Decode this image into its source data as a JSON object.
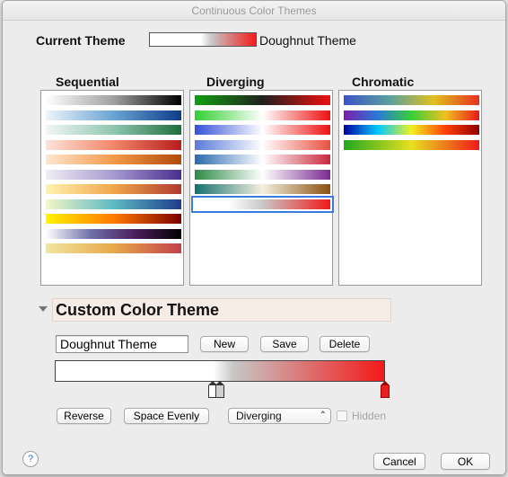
{
  "window": {
    "title": "Continuous Color Themes"
  },
  "current": {
    "label": "Current Theme",
    "name": "Doughnut Theme"
  },
  "columns": {
    "sequential": {
      "label": "Sequential",
      "swatches": [
        [
          "#ffffff",
          "#a0a0a0",
          "#000000"
        ],
        [
          "#eef4fb",
          "#6aa4d4",
          "#0d3d8a"
        ],
        [
          "#f3f6f5",
          "#8fc6b0",
          "#1f6e3c"
        ],
        [
          "#fde2d8",
          "#f2866b",
          "#b71d1d"
        ],
        [
          "#fde7cf",
          "#f39a4a",
          "#b24a0a"
        ],
        [
          "#f0eef6",
          "#a69ad0",
          "#4a2e8e"
        ],
        [
          "#fff3b0",
          "#f0a64a",
          "#b03a30"
        ],
        [
          "#f4f7c6",
          "#5fb9c4",
          "#1e3c8c"
        ],
        [
          "#fff400",
          "#ff7a00",
          "#7a0000"
        ],
        [
          "#ffffff",
          "#6e6eaa",
          "#4a1d5a",
          "#000000"
        ],
        [
          "#f0e6a0",
          "#e8a84a",
          "#c2404a"
        ]
      ]
    },
    "diverging": {
      "label": "Diverging",
      "swatches": [
        [
          "#10a010",
          "#202020",
          "#ee1010"
        ],
        [
          "#30d030",
          "#ffffff",
          "#ee1010"
        ],
        [
          "#3550d8",
          "#ffffff",
          "#ee1010"
        ],
        [
          "#5a7ad8",
          "#ffffff",
          "#e85040"
        ],
        [
          "#2a6ab0",
          "#ffffff",
          "#c8283c"
        ],
        [
          "#2e8a46",
          "#ffffff",
          "#7a2a90"
        ],
        [
          "#16706e",
          "#f4f0e0",
          "#8a5010"
        ],
        [
          "#ffffff",
          "#ffffff",
          "#c8c8c8",
          "#dd7070",
          "#f31919"
        ]
      ]
    },
    "chromatic": {
      "label": "Chromatic",
      "swatches": [
        [
          "#3d52c8",
          "#5aa0a0",
          "#e0c020",
          "#e83020"
        ],
        [
          "#7a1eaa",
          "#2a7ad8",
          "#38d038",
          "#f0c020",
          "#e81818"
        ],
        [
          "#0000a0",
          "#00c8ff",
          "#f0f020",
          "#ff4000",
          "#900000"
        ],
        [
          "#20a820",
          "#e8e020",
          "#f01818"
        ]
      ]
    }
  },
  "selected_diverging_index": 7,
  "custom": {
    "section_title": "Custom Color Theme",
    "name_value": "Doughnut Theme",
    "new_label": "New",
    "save_label": "Save",
    "delete_label": "Delete",
    "reverse_label": "Reverse",
    "space_evenly_label": "Space Evenly",
    "type_value": "Diverging",
    "hidden_label": "Hidden",
    "hidden_checked": false,
    "stops": [
      {
        "position": 0.47,
        "color": "#ffffff"
      },
      {
        "position": 0.5,
        "color": "#c8c8c8"
      },
      {
        "position": 1.0,
        "color": "#f31919"
      }
    ]
  },
  "footer": {
    "help_label": "?",
    "cancel_label": "Cancel",
    "ok_label": "OK"
  },
  "icons": {
    "help": "help-icon",
    "disclosure": "disclosure-triangle-icon",
    "select_chevron": "chevron-updown-icon"
  }
}
